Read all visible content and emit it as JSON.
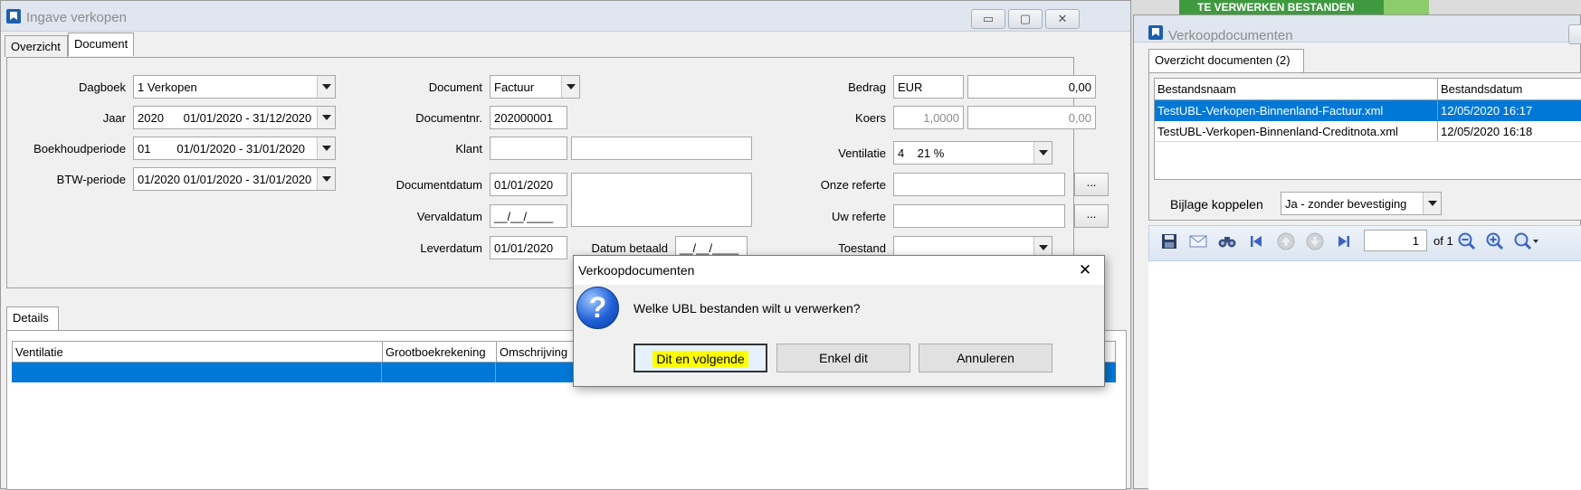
{
  "main_window": {
    "title": "Ingave verkopen",
    "window_buttons": {
      "minimize": "▭",
      "maximize": "▢",
      "close": "✕"
    },
    "tabs": [
      "Overzicht",
      "Document"
    ],
    "fields": {
      "dagboek": {
        "label": "Dagboek",
        "value": "1 Verkopen"
      },
      "jaar": {
        "label": "Jaar",
        "value": "2020      01/01/2020 - 31/12/2020"
      },
      "boekhoudperiode": {
        "label": "Boekhoudperiode",
        "value": "01        01/01/2020 - 31/01/2020"
      },
      "btw_periode": {
        "label": "BTW-periode",
        "value": "01/2020 01/01/2020 - 31/01/2020"
      },
      "document": {
        "label": "Document",
        "value": "Factuur"
      },
      "documentnr": {
        "label": "Documentnr.",
        "value": "202000001"
      },
      "klant": {
        "label": "Klant",
        "value": "",
        "value2": ""
      },
      "documentdatum": {
        "label": "Documentdatum",
        "value": "01/01/2020"
      },
      "vervaldatum": {
        "label": "Vervaldatum",
        "value": "__/__/____"
      },
      "leverdatum": {
        "label": "Leverdatum",
        "value": "01/01/2020"
      },
      "datum_betaald": {
        "label": "Datum betaald",
        "value": "__/__/____"
      },
      "bedrag": {
        "label": "Bedrag",
        "currency": "EUR",
        "value": "0,00"
      },
      "koers": {
        "label": "Koers",
        "value": "1,0000",
        "value2": "0,00"
      },
      "ventilatie": {
        "label": "Ventilatie",
        "value": "4    21 %"
      },
      "onze_referte": {
        "label": "Onze referte",
        "value": ""
      },
      "uw_referte": {
        "label": "Uw referte",
        "value": ""
      },
      "toestand": {
        "label": "Toestand",
        "value": ""
      },
      "ellipsis": "..."
    },
    "details_tab": "Details",
    "grid_columns": [
      "Ventilatie",
      "Grootboekrekening",
      "Omschrijving"
    ]
  },
  "side_window": {
    "banner": "TE VERWERKEN BESTANDEN",
    "title": "Verkoopdocumenten",
    "tab": "Overzicht documenten (2)",
    "columns": [
      "Bestandsnaam",
      "Bestandsdatum"
    ],
    "rows": [
      {
        "name": "TestUBL-Verkopen-Binnenland-Factuur.xml",
        "date": "12/05/2020 16:17"
      },
      {
        "name": "TestUBL-Verkopen-Binnenland-Creditnota.xml",
        "date": "12/05/2020 16:18"
      }
    ],
    "bijlage_label": "Bijlage koppelen",
    "bijlage_value": "Ja - zonder bevestiging",
    "page_value": "1",
    "page_of": "of 1"
  },
  "dialog": {
    "title": "Verkoopdocumenten",
    "close": "✕",
    "question_mark": "?",
    "message": "Welke UBL bestanden wilt u verwerken?",
    "buttons": {
      "dit_en_volgende": "Dit en volgende",
      "enkel_dit": "Enkel dit",
      "annuleren": "Annuleren"
    }
  },
  "colors": {
    "selection": "#0078d7",
    "highlight": "#ffff00",
    "banner": "#3f9a3f"
  }
}
